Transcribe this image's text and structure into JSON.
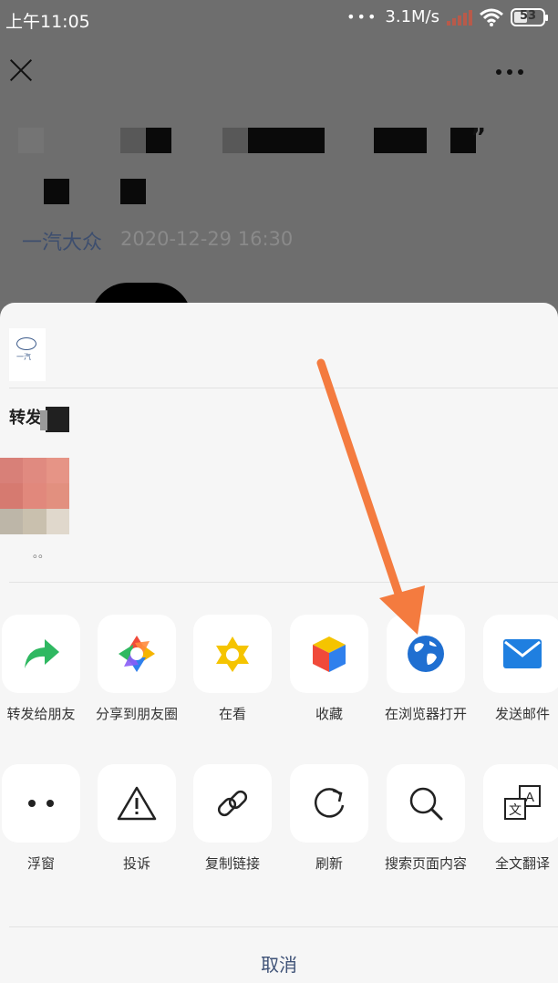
{
  "status_bar": {
    "time": "上午11:05",
    "dots": "•••",
    "net_speed": "3.1M/s",
    "battery": "53"
  },
  "article": {
    "quote_char": "”",
    "author": "一汽大众",
    "date": "2020-12-29 16:30"
  },
  "share_sheet": {
    "preview": {
      "logo_text": "一汽",
      "forward_text": "转发",
      "dots_text": "。。"
    },
    "row1": [
      {
        "label": "转发给朋友",
        "icon": "forward-arrow-icon"
      },
      {
        "label": "分享到朋友圈",
        "icon": "moments-aperture-icon"
      },
      {
        "label": "在看",
        "icon": "wow-star-icon"
      },
      {
        "label": "收藏",
        "icon": "favorites-cube-icon"
      },
      {
        "label": "在浏览器打开",
        "icon": "globe-icon"
      },
      {
        "label": "发送邮件",
        "icon": "mail-icon"
      }
    ],
    "row2": [
      {
        "label": "浮窗",
        "icon": "float-window-icon"
      },
      {
        "label": "投诉",
        "icon": "warning-icon"
      },
      {
        "label": "复制链接",
        "icon": "link-icon"
      },
      {
        "label": "刷新",
        "icon": "refresh-icon"
      },
      {
        "label": "搜索页面内容",
        "icon": "search-icon"
      },
      {
        "label": "全文翻译",
        "icon": "translate-icon"
      }
    ],
    "cancel": "取消"
  },
  "colors": {
    "accent_arrow": "#f47b3f",
    "link_blue": "#3f5277",
    "overlay": "#6e6e6e",
    "sheet_bg": "#f6f6f6"
  }
}
